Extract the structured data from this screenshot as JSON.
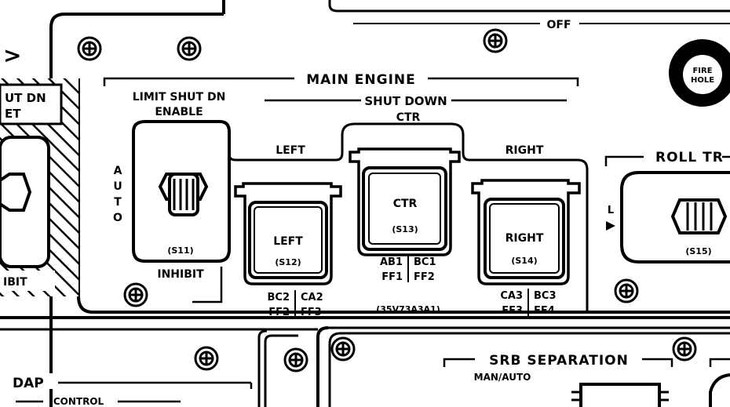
{
  "labels": {
    "main_engine": "MAIN ENGINE",
    "shut_down": "SHUT DOWN",
    "off": "OFF",
    "limit_1": "LIMIT SHUT DN",
    "limit_2": "ENABLE",
    "auto_letters": [
      "A",
      "U",
      "T",
      "O"
    ],
    "inhibit": "INHIBIT",
    "partial_1": "UT DN",
    "partial_2": "ET",
    "partial_inhibit": "IBIT",
    "arrow": ">",
    "left_top": "LEFT",
    "ctr_top": "CTR",
    "right_top": "RIGHT",
    "fire_1": "FIRE",
    "fire_2": "HOLE",
    "roll_tr": "ROLL TR",
    "roll_l": "L",
    "s11": "(S11)",
    "s15": "(S15)",
    "conn": "(35V73A3A1)",
    "srb": "SRB SEPARATION",
    "man_auto": "MAN/AUTO",
    "dap": "DAP",
    "control": "CONTROL"
  },
  "switches": [
    {
      "id": "left",
      "name": "LEFT",
      "tag": "(S12)",
      "bus": [
        [
          "BC2",
          "CA2"
        ],
        [
          "FF2",
          "FF3"
        ]
      ]
    },
    {
      "id": "ctr",
      "name": "CTR",
      "tag": "(S13)",
      "bus": [
        [
          "AB1",
          "BC1"
        ],
        [
          "FF1",
          "FF2"
        ]
      ]
    },
    {
      "id": "right",
      "name": "RIGHT",
      "tag": "(S14)",
      "bus": [
        [
          "CA3",
          "BC3"
        ],
        [
          "FF3",
          "FF4"
        ]
      ]
    }
  ]
}
